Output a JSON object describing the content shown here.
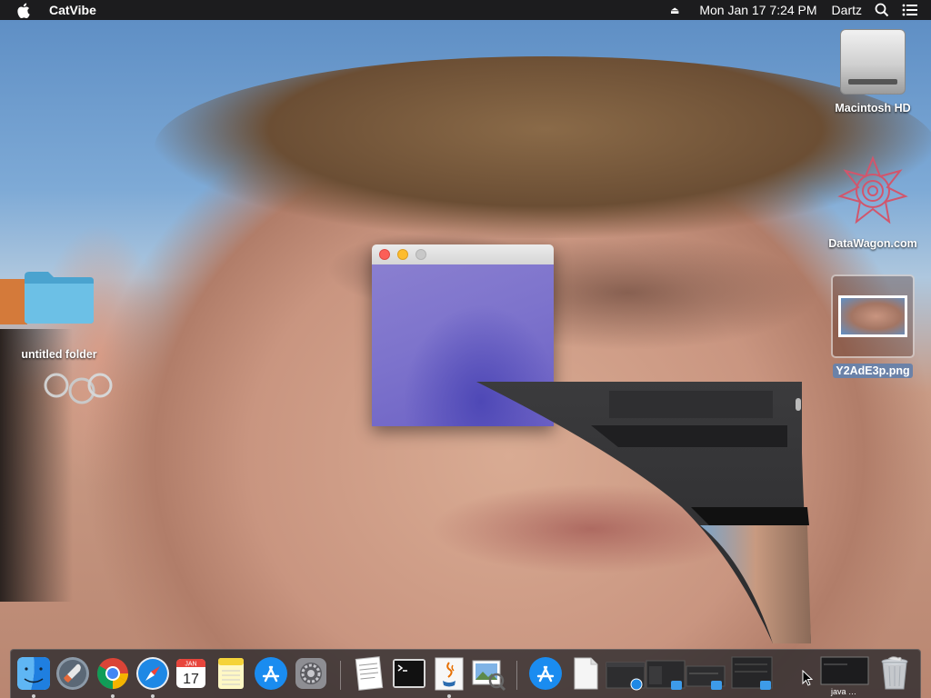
{
  "menubar": {
    "app_name": "CatVibe",
    "clock": "Mon Jan 17  7:24 PM",
    "user": "Dartz",
    "icons": [
      "apple-logo-icon",
      "eject-icon",
      "spotlight-search-icon",
      "notification-center-icon"
    ]
  },
  "desktop": {
    "items": [
      {
        "label": "Macintosh HD",
        "icon": "hard-drive-icon"
      },
      {
        "label": "DataWagon.com",
        "icon": "mandala-logo-icon"
      },
      {
        "label": "Y2AdE3p.png",
        "icon": "image-file-icon",
        "selected": true
      },
      {
        "label": "untitled folder",
        "icon": "folder-icon"
      }
    ]
  },
  "mini_window": {
    "traffic_lights": [
      "close",
      "minimize",
      "zoom"
    ],
    "content_icon": "purple-image-preview"
  },
  "dock": {
    "apps": [
      {
        "name": "Finder",
        "icon": "finder-icon",
        "running": true
      },
      {
        "name": "Launchpad",
        "icon": "launchpad-rocket-icon",
        "running": false
      },
      {
        "name": "Google Chrome",
        "icon": "chrome-icon",
        "running": true
      },
      {
        "name": "Safari",
        "icon": "safari-compass-icon",
        "running": true
      },
      {
        "name": "Calendar",
        "icon": "calendar-icon",
        "running": false,
        "month": "JAN",
        "day": "17"
      },
      {
        "name": "Notes",
        "icon": "notes-icon",
        "running": false
      },
      {
        "name": "App Store",
        "icon": "app-store-icon",
        "running": false
      },
      {
        "name": "System Preferences",
        "icon": "gear-icon",
        "running": false
      },
      {
        "name": "TextEdit",
        "icon": "textedit-icon",
        "running": false
      },
      {
        "name": "Terminal",
        "icon": "terminal-icon",
        "running": false
      },
      {
        "name": "Java",
        "icon": "java-coffee-icon",
        "running": true
      },
      {
        "name": "Preview",
        "icon": "preview-icon",
        "running": false
      }
    ],
    "recent": [
      {
        "name": "App Store",
        "icon": "app-store-icon"
      },
      {
        "name": "Document",
        "icon": "document-icon"
      },
      {
        "name": "Safari window",
        "icon": "minimized-window-icon"
      },
      {
        "name": "Finder window",
        "icon": "minimized-window-icon"
      },
      {
        "name": "Finder window",
        "icon": "minimized-window-icon"
      },
      {
        "name": "Finder window",
        "icon": "minimized-window-icon"
      }
    ],
    "minimized_caption": "java …",
    "trash_icon": "trash-icon"
  },
  "colors": {
    "menubar_bg": "#1c1c1e",
    "close": "#fc5f57",
    "minimize": "#fdbc2e",
    "zoom_inactive": "#c8c8c8",
    "window_content": "#7d73cc"
  }
}
